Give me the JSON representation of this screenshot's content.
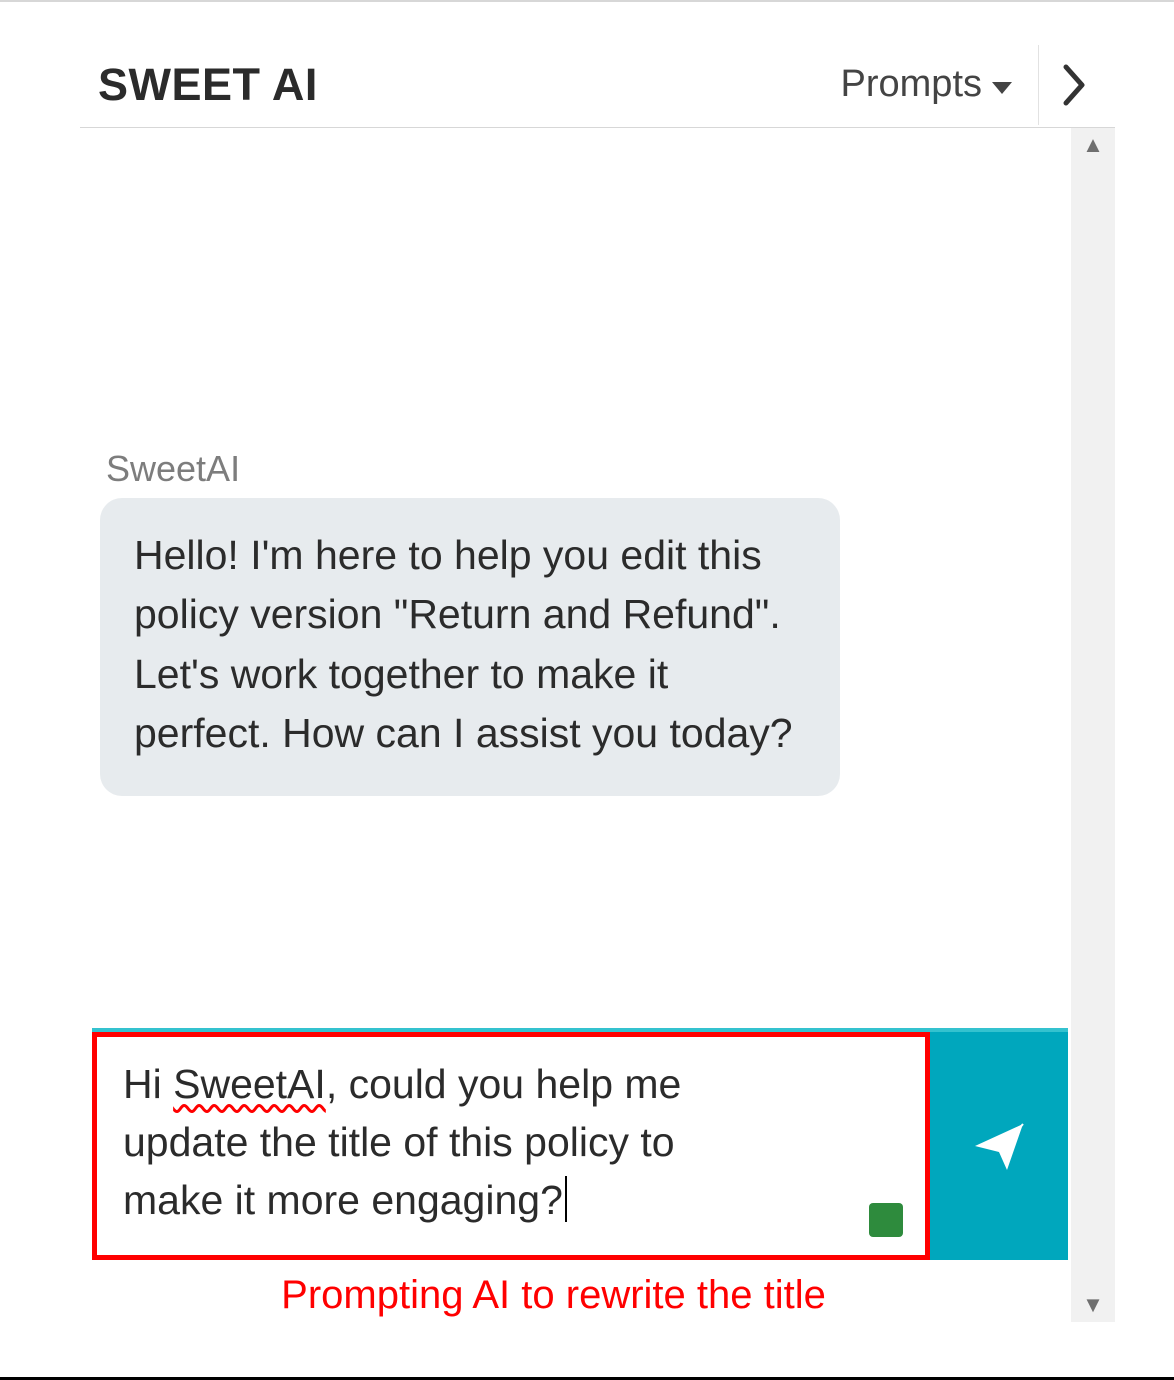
{
  "header": {
    "title": "SWEET AI",
    "prompts_label": "Prompts"
  },
  "chat": {
    "messages": [
      {
        "sender": "SweetAI",
        "text": "Hello! I'm here to help you edit this policy version \"Return and Refund\". Let's work together to make it perfect. How can I assist you today?"
      }
    ]
  },
  "input": {
    "line1_pre": "Hi ",
    "line1_spell": "SweetAI",
    "line1_post": ", could you help me",
    "line2": "update the title of this policy to",
    "line3": "make it more engaging?"
  },
  "annotation": "Prompting AI to rewrite the title",
  "icons": {
    "caret_down": "caret-down-icon",
    "chevron_right": "chevron-right-icon",
    "send": "paper-plane-icon",
    "scroll_up": "scroll-up-icon",
    "scroll_down": "scroll-down-icon",
    "grammarly": "grammar-check-indicator"
  },
  "colors": {
    "accent": "#00a7bd",
    "highlight_border": "#ff0000",
    "bubble_bg": "#e7ebee"
  }
}
